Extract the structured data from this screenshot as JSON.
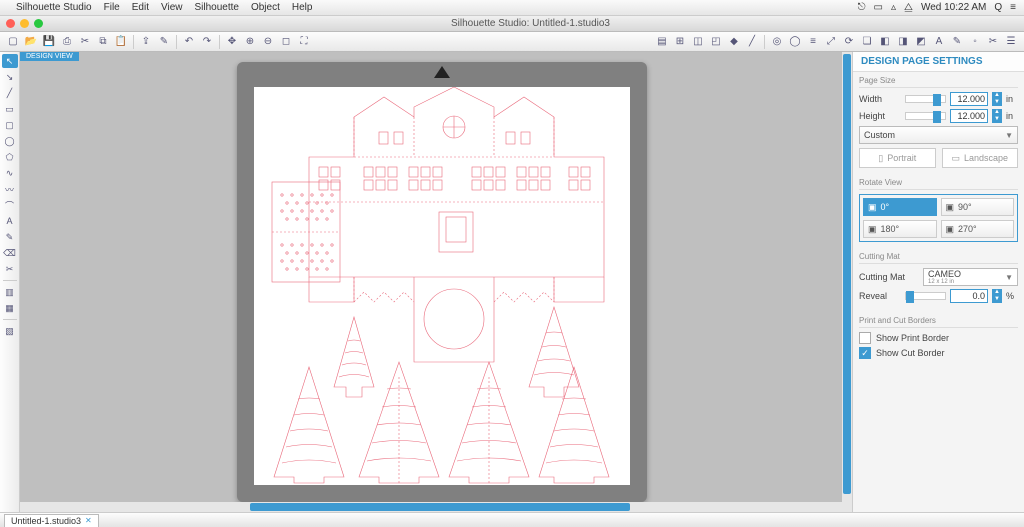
{
  "menubar": {
    "app_name": "Silhouette Studio",
    "items": [
      "File",
      "Edit",
      "View",
      "Silhouette",
      "Object",
      "Help"
    ],
    "clock": "Wed 10:22 AM"
  },
  "window": {
    "title": "Silhouette Studio: Untitled-1.studio3"
  },
  "canvas": {
    "design_view_label": "DESIGN VIEW"
  },
  "panel": {
    "header": "DESIGN PAGE SETTINGS",
    "page_size": {
      "title": "Page Size",
      "width_label": "Width",
      "width_value": "12.000",
      "width_unit": "in",
      "height_label": "Height",
      "height_value": "12.000",
      "height_unit": "in",
      "preset": "Custom",
      "portrait": "Portrait",
      "landscape": "Landscape"
    },
    "rotate": {
      "title": "Rotate View",
      "r0": "0°",
      "r90": "90°",
      "r180": "180°",
      "r270": "270°"
    },
    "mat": {
      "title": "Cutting Mat",
      "label": "Cutting Mat",
      "value": "CAMEO",
      "sub": "12 x 12 in",
      "reveal_label": "Reveal",
      "reveal_value": "0.0",
      "reveal_unit": "%"
    },
    "borders": {
      "title": "Print and Cut Borders",
      "print": "Show Print Border",
      "cut": "Show Cut Border"
    }
  },
  "tabs": {
    "doc1": "Untitled-1.studio3"
  }
}
